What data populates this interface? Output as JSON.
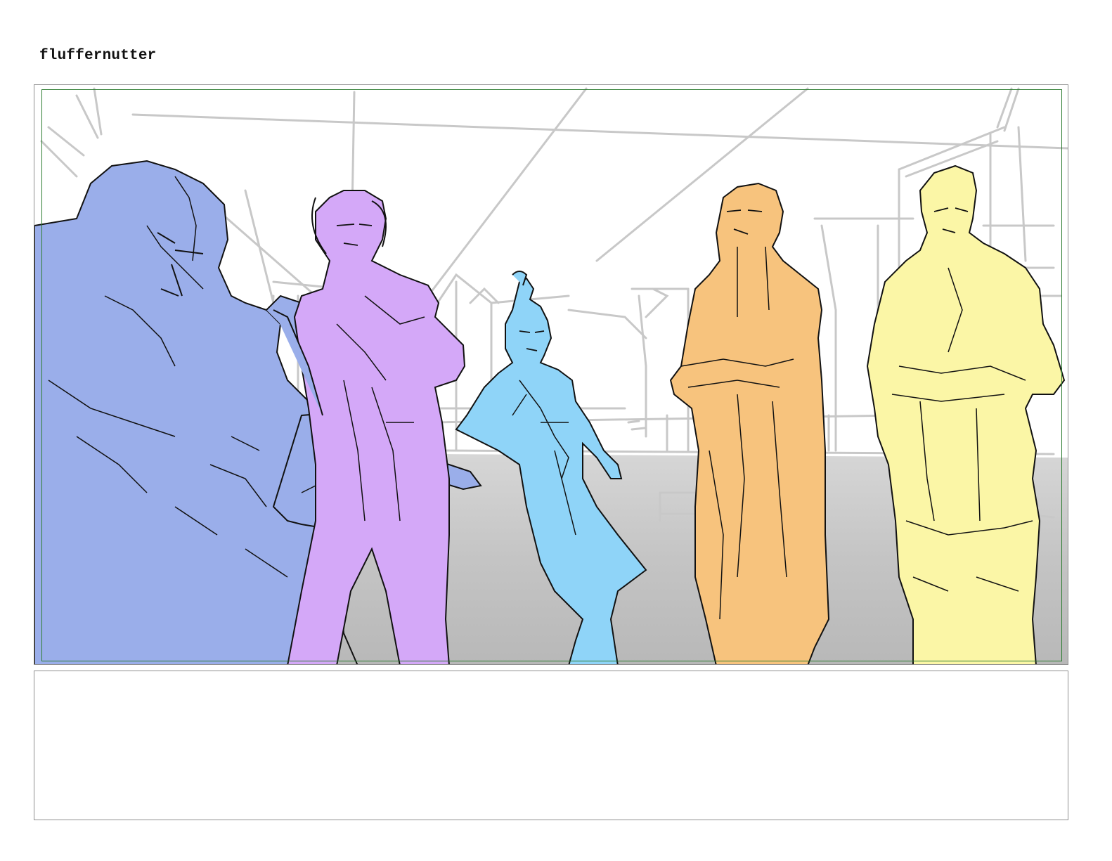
{
  "page": {
    "title": "fluffernutter"
  },
  "panel": {
    "characters": [
      {
        "name": "blue-character",
        "color": "#9aaeea"
      },
      {
        "name": "purple-character",
        "color": "#d4a8f8"
      },
      {
        "name": "cyan-character",
        "color": "#8fd4f8"
      },
      {
        "name": "orange-character",
        "color": "#f7c37d"
      },
      {
        "name": "yellow-character",
        "color": "#fbf6a6"
      }
    ],
    "colors": {
      "safe_frame": "#2e7d32",
      "sketch_lines": "#c9c9c9",
      "ground": "#bdbdbd",
      "ink": "#111111"
    }
  },
  "notes": {
    "text": ""
  }
}
